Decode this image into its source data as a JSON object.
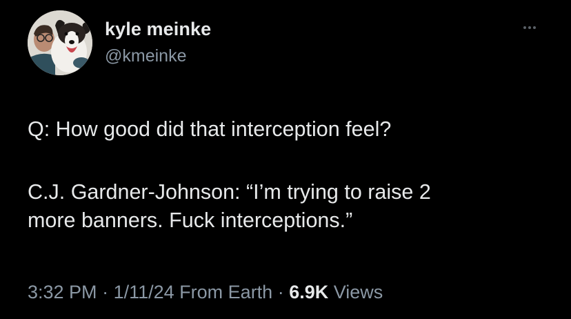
{
  "author": {
    "display_name": "kyle meinke",
    "handle": "@kmeinke",
    "avatar_icon": "profile-photo-with-dog"
  },
  "menu_icon": "more-horizontal-icon",
  "tweet": {
    "paragraphs": [
      "Q: How good did that interception feel?",
      "C.J. Gardner-Johnson: “I’m trying to raise 2\nmore banners. Fuck interceptions.”"
    ]
  },
  "meta": {
    "time": "3:32 PM",
    "separator": " · ",
    "date": "1/11/24",
    "source": "From Earth",
    "views_count": "6.9K",
    "views_label": "Views"
  },
  "colors": {
    "background": "#000000",
    "primary_text": "#e7e9ea",
    "secondary_text": "#8b98a5"
  }
}
